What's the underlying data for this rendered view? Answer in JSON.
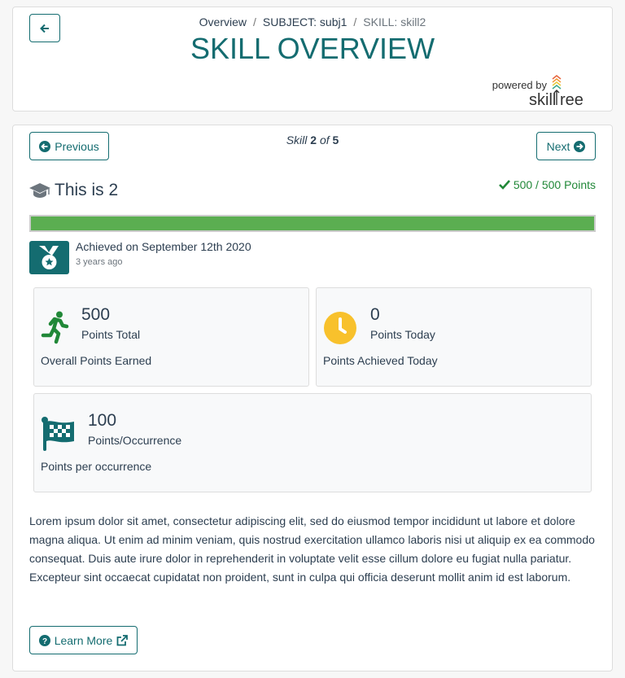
{
  "header": {
    "back_icon": "arrow-left-icon",
    "breadcrumb": [
      {
        "label": "Overview"
      },
      {
        "label": "SUBJECT: subj1"
      },
      {
        "label": "SKILL: skill2"
      }
    ],
    "title": "SKILL OVERVIEW",
    "powered_by": "powered by",
    "logo_text": "skilltree"
  },
  "nav": {
    "previous": "Previous",
    "next": "Next",
    "skill_word": "Skill",
    "current": "2",
    "of_word": "of",
    "total": "5"
  },
  "skill": {
    "name": "This is 2",
    "icon": "graduation-cap-icon",
    "points_label": "500 / 500 Points",
    "points_earned": 500,
    "points_total": 500,
    "progress_color": "#5bae51",
    "achieved": "Achieved on September 12th 2020",
    "achieved_ago": "3 years ago"
  },
  "stats": [
    {
      "value": "500",
      "label": "Points Total",
      "desc": "Overall Points Earned",
      "icon": "running-person-icon"
    },
    {
      "value": "0",
      "label": "Points Today",
      "desc": "Points Achieved Today",
      "icon": "clock-icon"
    },
    {
      "value": "100",
      "label": "Points/Occurrence",
      "desc": "Points per occurrence",
      "icon": "checkered-flag-icon"
    }
  ],
  "description": "Lorem ipsum dolor sit amet, consectetur adipiscing elit, sed do eiusmod tempor incididunt ut labore et dolore magna aliqua. Ut enim ad minim veniam, quis nostrud exercitation ullamco laboris nisi ut aliquip ex ea commodo consequat. Duis aute irure dolor in reprehenderit in voluptate velit esse cillum dolore eu fugiat nulla pariatur. Excepteur sint occaecat cupidatat non proident, sunt in culpa qui officia deserunt mollit anim id est laborum.",
  "learn_more": "Learn More",
  "colors": {
    "primary": "#146c70",
    "success": "#218838",
    "warning": "#f8c12c"
  }
}
